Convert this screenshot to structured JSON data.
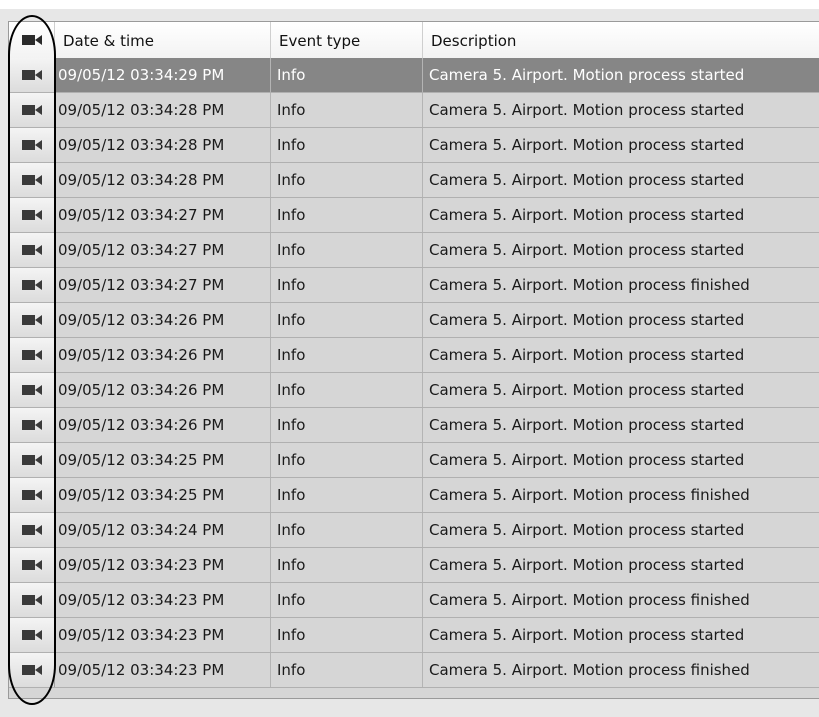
{
  "columns": {
    "icon": "camera-icon",
    "date": "Date & time",
    "type": "Event type",
    "description": "Description"
  },
  "rows": [
    {
      "date": "09/05/12 03:34:29 PM",
      "type": "Info",
      "description": "Camera 5. Airport. Motion process started",
      "selected": true
    },
    {
      "date": "09/05/12 03:34:28 PM",
      "type": "Info",
      "description": "Camera 5. Airport. Motion process started"
    },
    {
      "date": "09/05/12 03:34:28 PM",
      "type": "Info",
      "description": "Camera 5. Airport. Motion process started"
    },
    {
      "date": "09/05/12 03:34:28 PM",
      "type": "Info",
      "description": "Camera 5. Airport. Motion process started"
    },
    {
      "date": "09/05/12 03:34:27 PM",
      "type": "Info",
      "description": "Camera 5. Airport. Motion process started"
    },
    {
      "date": "09/05/12 03:34:27 PM",
      "type": "Info",
      "description": "Camera 5. Airport. Motion process started"
    },
    {
      "date": "09/05/12 03:34:27 PM",
      "type": "Info",
      "description": "Camera 5. Airport. Motion process finished"
    },
    {
      "date": "09/05/12 03:34:26 PM",
      "type": "Info",
      "description": "Camera 5. Airport. Motion process started"
    },
    {
      "date": "09/05/12 03:34:26 PM",
      "type": "Info",
      "description": "Camera 5. Airport. Motion process started"
    },
    {
      "date": "09/05/12 03:34:26 PM",
      "type": "Info",
      "description": "Camera 5. Airport. Motion process started"
    },
    {
      "date": "09/05/12 03:34:26 PM",
      "type": "Info",
      "description": "Camera 5. Airport. Motion process started"
    },
    {
      "date": "09/05/12 03:34:25 PM",
      "type": "Info",
      "description": "Camera 5. Airport. Motion process started"
    },
    {
      "date": "09/05/12 03:34:25 PM",
      "type": "Info",
      "description": "Camera 5. Airport. Motion process finished"
    },
    {
      "date": "09/05/12 03:34:24 PM",
      "type": "Info",
      "description": "Camera 5. Airport. Motion process started"
    },
    {
      "date": "09/05/12 03:34:23 PM",
      "type": "Info",
      "description": "Camera 5. Airport. Motion process started"
    },
    {
      "date": "09/05/12 03:34:23 PM",
      "type": "Info",
      "description": "Camera 5. Airport. Motion process finished"
    },
    {
      "date": "09/05/12 03:34:23 PM",
      "type": "Info",
      "description": "Camera 5. Airport. Motion process started"
    },
    {
      "date": "09/05/12 03:34:23 PM",
      "type": "Info",
      "description": "Camera 5. Airport. Motion process finished"
    }
  ],
  "colors": {
    "selected_row": "#868686",
    "grid_background": "#d6d6d6",
    "annotation_ellipse": "#000000"
  }
}
